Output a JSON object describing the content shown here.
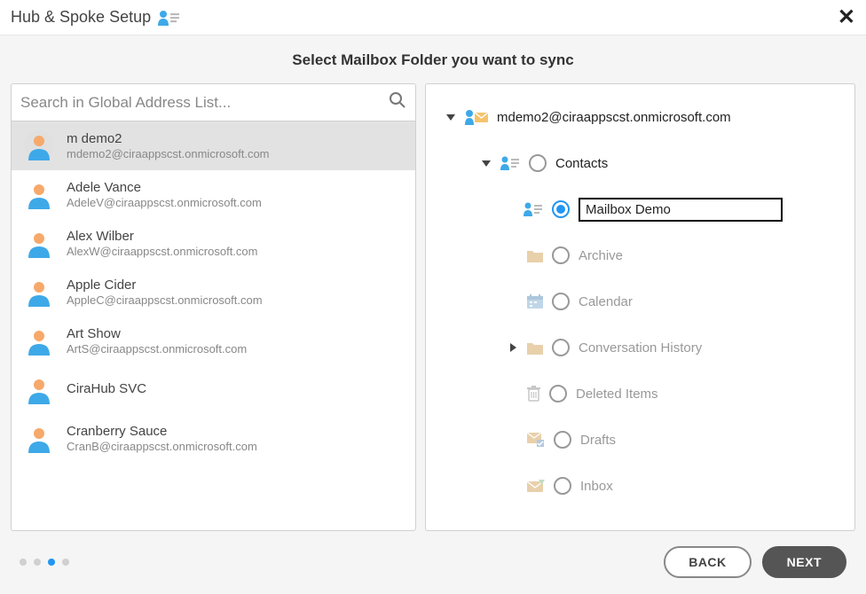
{
  "header": {
    "title": "Hub & Spoke Setup"
  },
  "subtitle": "Select Mailbox Folder you want to sync",
  "search": {
    "placeholder": "Search in Global Address List..."
  },
  "users": [
    {
      "name": "m demo2",
      "email": "mdemo2@ciraappscst.onmicrosoft.com",
      "selected": true
    },
    {
      "name": "Adele Vance",
      "email": "AdeleV@ciraappscst.onmicrosoft.com"
    },
    {
      "name": "Alex Wilber",
      "email": "AlexW@ciraappscst.onmicrosoft.com"
    },
    {
      "name": "Apple Cider",
      "email": "AppleC@ciraappscst.onmicrosoft.com"
    },
    {
      "name": "Art Show",
      "email": "ArtS@ciraappscst.onmicrosoft.com"
    },
    {
      "name": "CiraHub SVC",
      "email": ""
    },
    {
      "name": "Cranberry Sauce",
      "email": "CranB@ciraappscst.onmicrosoft.com"
    }
  ],
  "tree": {
    "root_email": "mdemo2@ciraappscst.onmicrosoft.com",
    "contacts_label": "Contacts",
    "selected_folder_value": "Mailbox Demo",
    "archive": "Archive",
    "calendar": "Calendar",
    "conversation_history": "Conversation History",
    "deleted_items": "Deleted Items",
    "drafts": "Drafts",
    "inbox": "Inbox"
  },
  "footer": {
    "back_label": "BACK",
    "next_label": "NEXT",
    "active_step": 2,
    "total_steps": 4
  },
  "icons": {
    "person_head": "#f6a96b",
    "person_body": "#3ea9e8",
    "accent_blue": "#3ea9e8",
    "folder_muted": "#e8a94a"
  }
}
